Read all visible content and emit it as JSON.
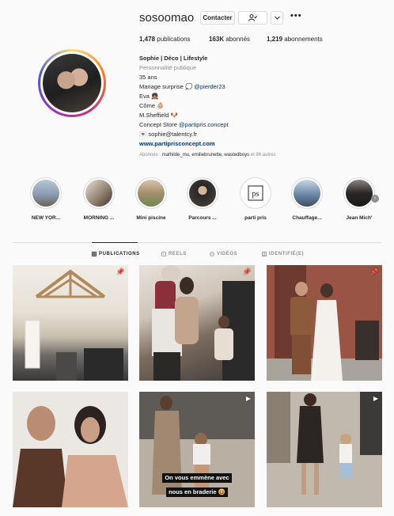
{
  "profile": {
    "username": "sosoomao",
    "contact_label": "Contacter",
    "follow_icon": "person-check-icon",
    "more_icon": "chevron-down-icon",
    "options_icon": "more-dots-icon",
    "stats": {
      "posts_value": "1,478",
      "posts_label": "publications",
      "followers_value": "163K",
      "followers_label": "abonnés",
      "following_value": "1,219",
      "following_label": "abonnements"
    },
    "bio": {
      "name": "Sophie | Déco | Lifestyle",
      "category": "Personnalité publique",
      "line1": "35 ans",
      "line2_text": "Mariage surprise 💭",
      "line2_link": "@pierder23",
      "line3": "Eva 👧🏽",
      "line4": "Côme 👶🏼",
      "line5": "M.Sheffield 🐶",
      "line6_text": "Concept Store",
      "line6_link": "@partipris.concept",
      "line7": "💌 sophie@talentcy.fr",
      "website": "www.partiprisconcept.com"
    },
    "followed_by_prefix": "Abonnés :",
    "followed_by_names": "mathilde_mu, emiliebrunette, wastedboys",
    "followed_by_suffix": "et 86 autres"
  },
  "highlights": [
    {
      "label": "NEW YOR...",
      "color": "#8fa3b8"
    },
    {
      "label": "MORNING ...",
      "color": "#9c8d7d"
    },
    {
      "label": "Mini piscine",
      "color": "#a79074"
    },
    {
      "label": "Parcours ...",
      "color": "#3b3733"
    },
    {
      "label": "parti pris",
      "color": "#ffffff"
    },
    {
      "label": "Chauffage...",
      "color": "#7d97b5"
    },
    {
      "label": "Jean Mich'",
      "color": "#2f2d2c"
    }
  ],
  "highlight_next_icon": "chevron-right-icon",
  "tabs": [
    {
      "label": "PUBLICATIONS",
      "icon": "grid-icon",
      "active": true
    },
    {
      "label": "REELS",
      "icon": "reels-icon",
      "active": false
    },
    {
      "label": "VIDÉOS",
      "icon": "video-icon",
      "active": false
    },
    {
      "label": "IDENTIFIÉ(E)",
      "icon": "tagged-icon",
      "active": false
    }
  ],
  "posts": [
    {
      "type": "pinned",
      "badge_icon": "pin-icon"
    },
    {
      "type": "pinned",
      "badge_icon": "pin-icon"
    },
    {
      "type": "pinned",
      "badge_icon": "pin-icon"
    },
    {
      "type": "photo"
    },
    {
      "type": "reel",
      "badge_icon": "reel-icon",
      "caption_line1": "On vous emmène avec",
      "caption_line2": "nous en braderie 😆"
    },
    {
      "type": "reel",
      "badge_icon": "reel-icon"
    }
  ]
}
